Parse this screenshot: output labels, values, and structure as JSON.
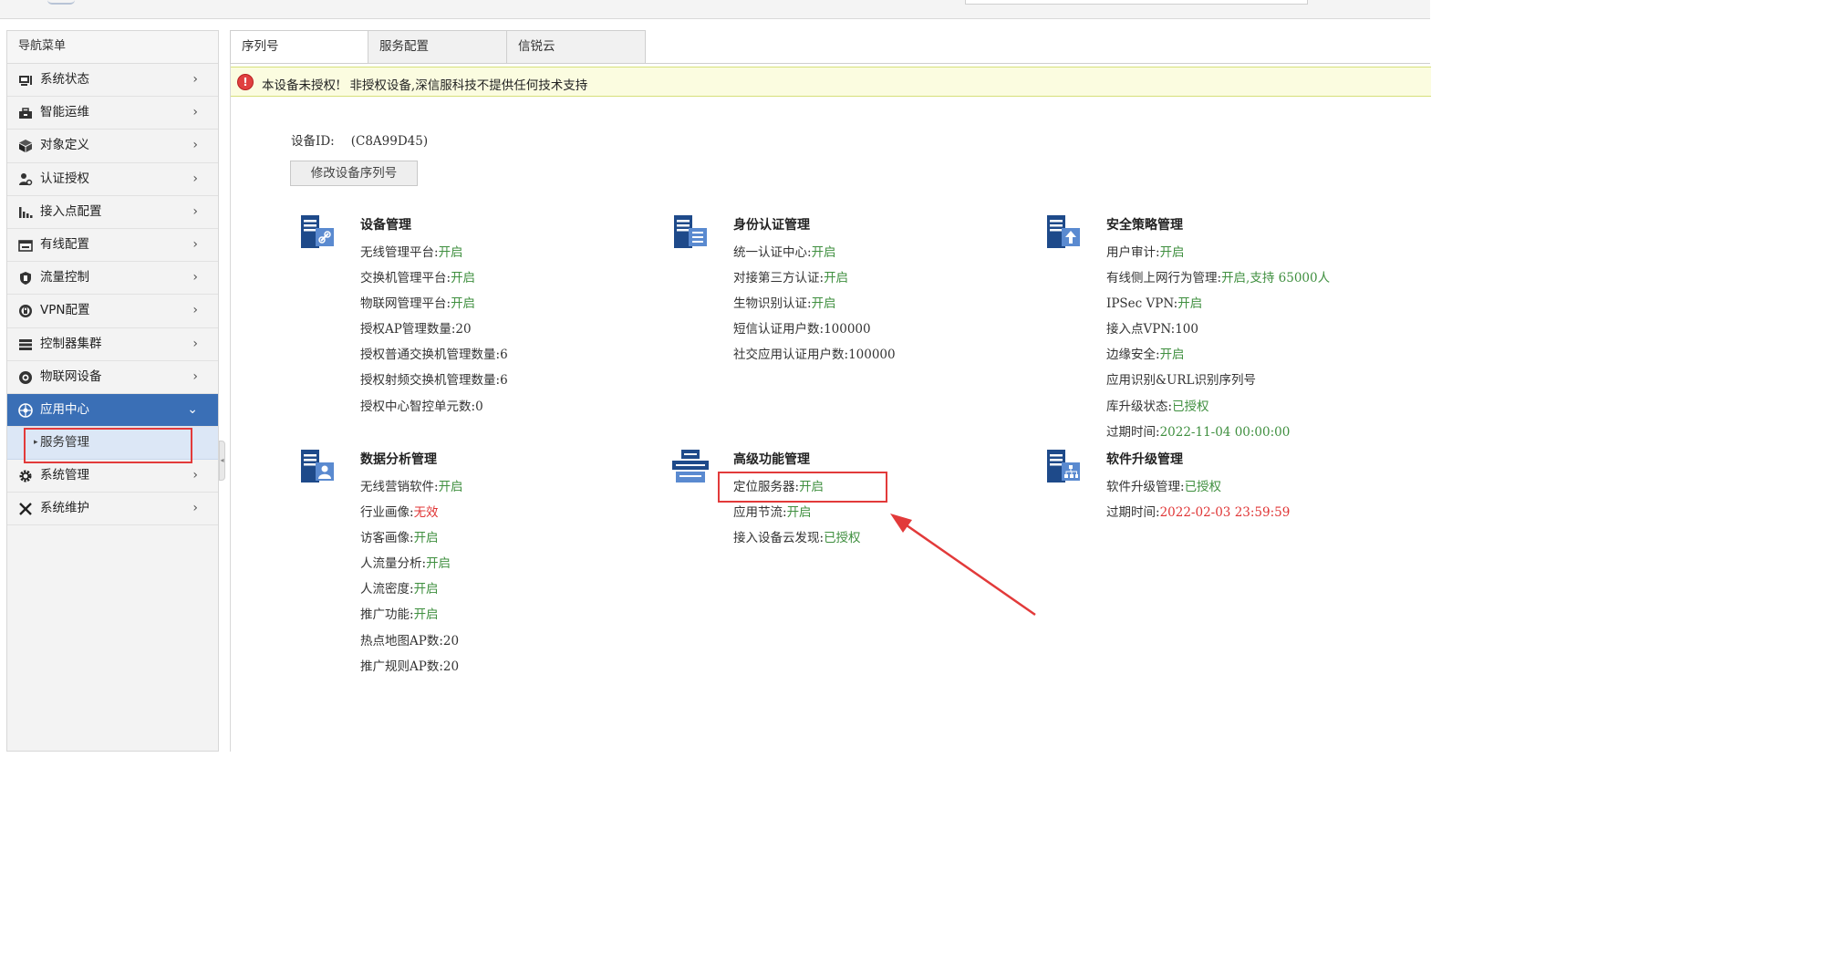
{
  "sidebar": {
    "title": "导航菜单",
    "items": [
      {
        "label": "系统状态",
        "icon": "monitor-icon"
      },
      {
        "label": "智能运维",
        "icon": "toolbox-icon"
      },
      {
        "label": "对象定义",
        "icon": "cube-icon"
      },
      {
        "label": "认证授权",
        "icon": "user-key-icon"
      },
      {
        "label": "接入点配置",
        "icon": "signal-bars-icon"
      },
      {
        "label": "有线配置",
        "icon": "wired-icon"
      },
      {
        "label": "流量控制",
        "icon": "shield-icon"
      },
      {
        "label": "VPN配置",
        "icon": "vpn-lock-icon"
      },
      {
        "label": "控制器集群",
        "icon": "server-rack-icon"
      },
      {
        "label": "物联网设备",
        "icon": "iot-camera-icon"
      },
      {
        "label": "应用中心",
        "icon": "app-center-icon",
        "active": true
      },
      {
        "label": "系统管理",
        "icon": "gear-icon"
      },
      {
        "label": "系统维护",
        "icon": "tools-icon"
      }
    ],
    "sub_item": "服务管理"
  },
  "tabs": [
    "序列号",
    "服务配置",
    "信锐云"
  ],
  "warning": {
    "title": "本设备未授权!",
    "message": "非授权设备,深信服科技不提供任何技术支持"
  },
  "device": {
    "id_label": "设备ID:",
    "id_value": "(C8A99D45)",
    "modify_button": "修改设备序列号"
  },
  "sections": [
    {
      "title": "设备管理",
      "icon": "server-link-icon",
      "rows": [
        {
          "label": "无线管理平台:",
          "value": "开启",
          "color": "#3f8f3f"
        },
        {
          "label": "交换机管理平台:",
          "value": "开启",
          "color": "#3f8f3f"
        },
        {
          "label": "物联网管理平台:",
          "value": "开启",
          "color": "#3f8f3f"
        },
        {
          "label": "授权AP管理数量:",
          "value": "20"
        },
        {
          "label": "授权普通交换机管理数量:",
          "value": "6"
        },
        {
          "label": "授权射频交换机管理数量:",
          "value": "6"
        },
        {
          "label": "授权中心智控单元数:",
          "value": "0"
        }
      ]
    },
    {
      "title": "身份认证管理",
      "icon": "server-list-icon",
      "rows": [
        {
          "label": "统一认证中心:",
          "value": "开启",
          "color": "#3f8f3f"
        },
        {
          "label": "对接第三方认证:",
          "value": "开启",
          "color": "#3f8f3f"
        },
        {
          "label": "生物识别认证:",
          "value": "开启",
          "color": "#3f8f3f"
        },
        {
          "label": "短信认证用户数:",
          "value": "100000"
        },
        {
          "label": "社交应用认证用户数:",
          "value": "100000"
        }
      ]
    },
    {
      "title": "安全策略管理",
      "icon": "server-upload-icon",
      "rows": [
        {
          "label": "用户审计:",
          "value": "开启",
          "color": "#3f8f3f"
        },
        {
          "label": "有线侧上网行为管理:",
          "value": "开启,支持 65000人",
          "color": "#3f8f3f"
        },
        {
          "label": "IPSec VPN:",
          "value": "开启",
          "color": "#3f8f3f"
        },
        {
          "label": "接入点VPN:",
          "value": "100"
        },
        {
          "label": "边缘安全:",
          "value": "开启",
          "color": "#3f8f3f"
        },
        {
          "label": "应用识别&URL识别序列号",
          "value": ""
        },
        {
          "label": "库升级状态:",
          "value": "已授权",
          "color": "#3f8f3f"
        },
        {
          "label": "过期时间:",
          "value": "2022-11-04 00:00:00",
          "color": "#3f8f3f"
        }
      ]
    },
    {
      "title": "数据分析管理",
      "icon": "server-user-icon",
      "rows": [
        {
          "label": "无线营销软件:",
          "value": "开启",
          "color": "#3f8f3f"
        },
        {
          "label": "行业画像:",
          "value": "无效",
          "color": "#e03535"
        },
        {
          "label": "访客画像:",
          "value": "开启",
          "color": "#3f8f3f"
        },
        {
          "label": "人流量分析:",
          "value": "开启",
          "color": "#3f8f3f"
        },
        {
          "label": "人流密度:",
          "value": "开启",
          "color": "#3f8f3f"
        },
        {
          "label": "推广功能:",
          "value": "开启",
          "color": "#3f8f3f"
        },
        {
          "label": "热点地图AP数:",
          "value": "20"
        },
        {
          "label": "推广规则AP数:",
          "value": "20"
        }
      ]
    },
    {
      "title": "高级功能管理",
      "icon": "server-cluster-icon",
      "rows": [
        {
          "label": "定位服务器:",
          "value": "开启",
          "color": "#3f8f3f"
        },
        {
          "label": "应用节流:",
          "value": "开启",
          "color": "#3f8f3f"
        },
        {
          "label": "接入设备云发现:",
          "value": "已授权",
          "color": "#3f8f3f"
        }
      ]
    },
    {
      "title": "软件升级管理",
      "icon": "server-tree-icon",
      "rows": [
        {
          "label": "软件升级管理:",
          "value": "已授权",
          "color": "#3f8f3f"
        },
        {
          "label": "过期时间:",
          "value": "2022-02-03 23:59:59",
          "color": "#e03535"
        }
      ]
    }
  ],
  "colors": {
    "accent": "#3a6fb6",
    "enabled": "#3f8f3f",
    "disabled": "#e03535",
    "annotation": "#e23a3a"
  }
}
